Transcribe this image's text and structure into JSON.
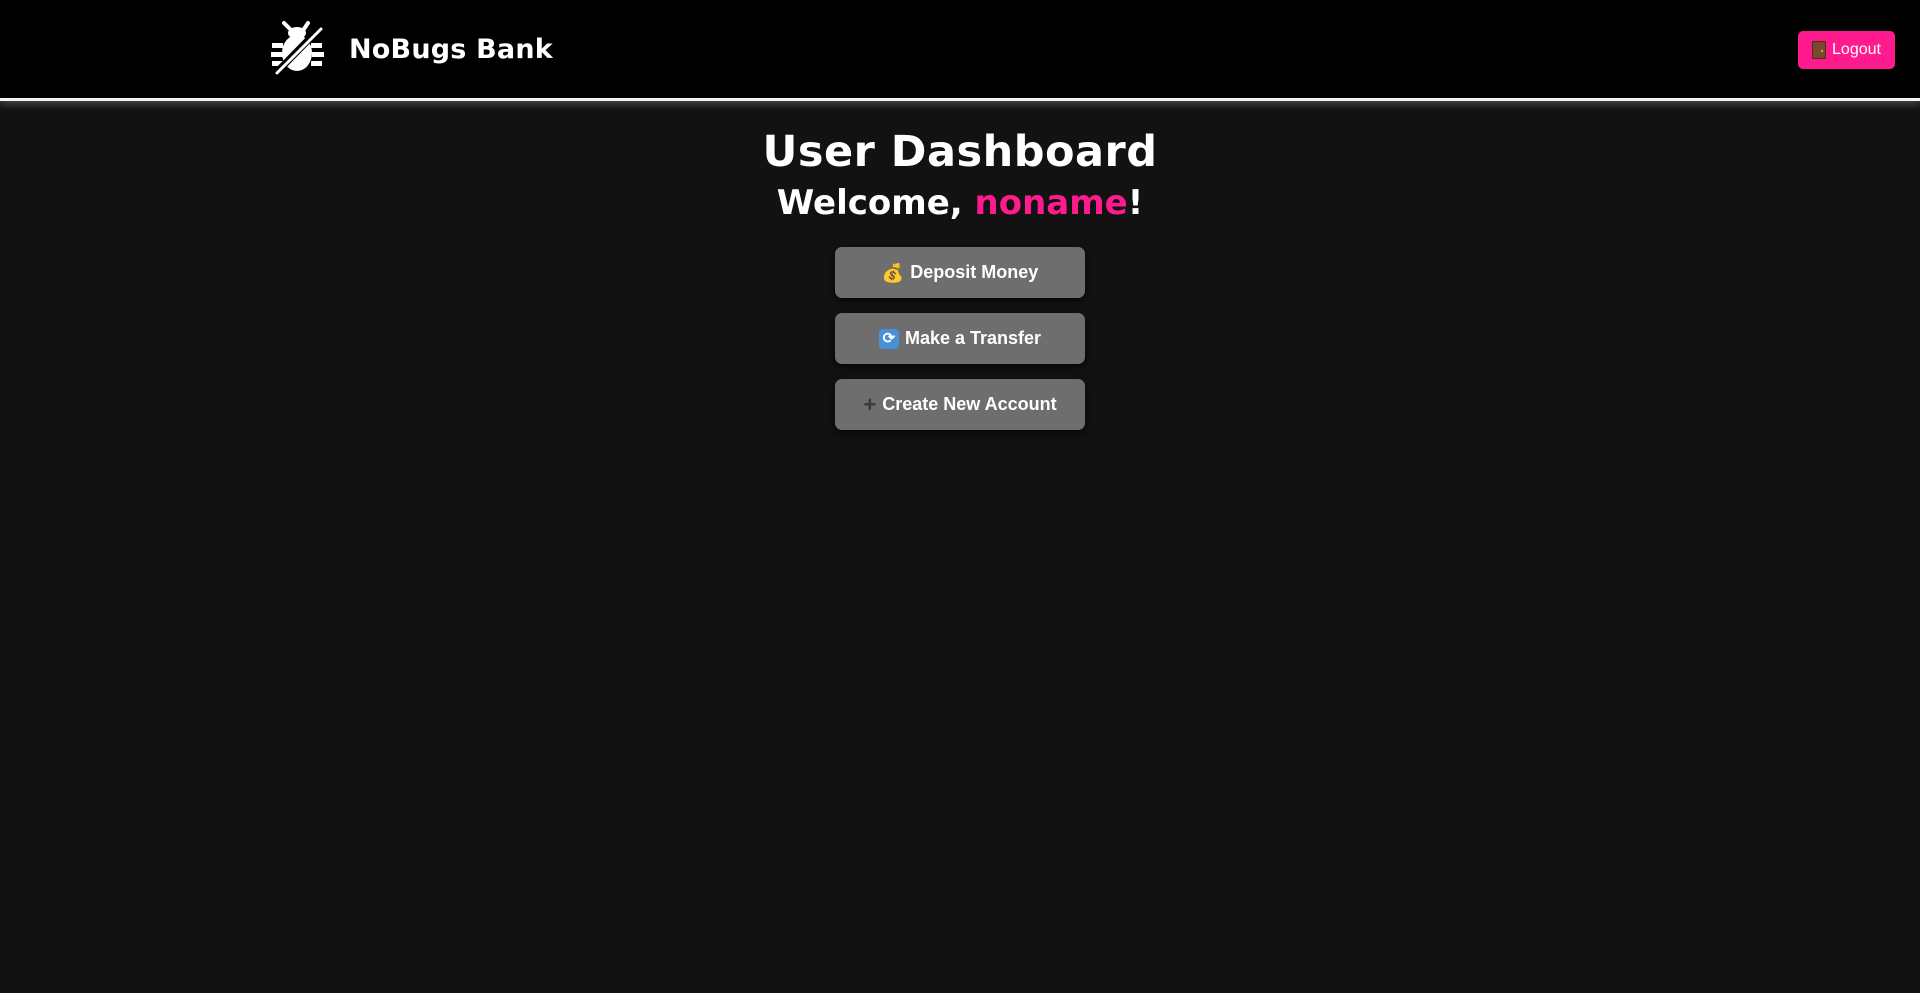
{
  "header": {
    "brand_name": "NoBugs Bank",
    "logo_icon": "bug-icon",
    "logout_label": "Logout",
    "logout_icon": "door-icon"
  },
  "main": {
    "title": "User Dashboard",
    "welcome_prefix": "Welcome, ",
    "username": "noname",
    "welcome_suffix": "!",
    "actions": [
      {
        "label": "Deposit Money",
        "icon": "money-bag-icon",
        "icon_glyph": "💰"
      },
      {
        "label": "Make a Transfer",
        "icon": "transfer-icon",
        "icon_glyph": "🔄"
      },
      {
        "label": "Create New Account",
        "icon": "plus-icon",
        "icon_glyph": "➕"
      }
    ]
  },
  "colors": {
    "accent": "#ff1b8d",
    "background": "#121212",
    "header_background": "#000000",
    "button_background": "#6e6e6e"
  }
}
